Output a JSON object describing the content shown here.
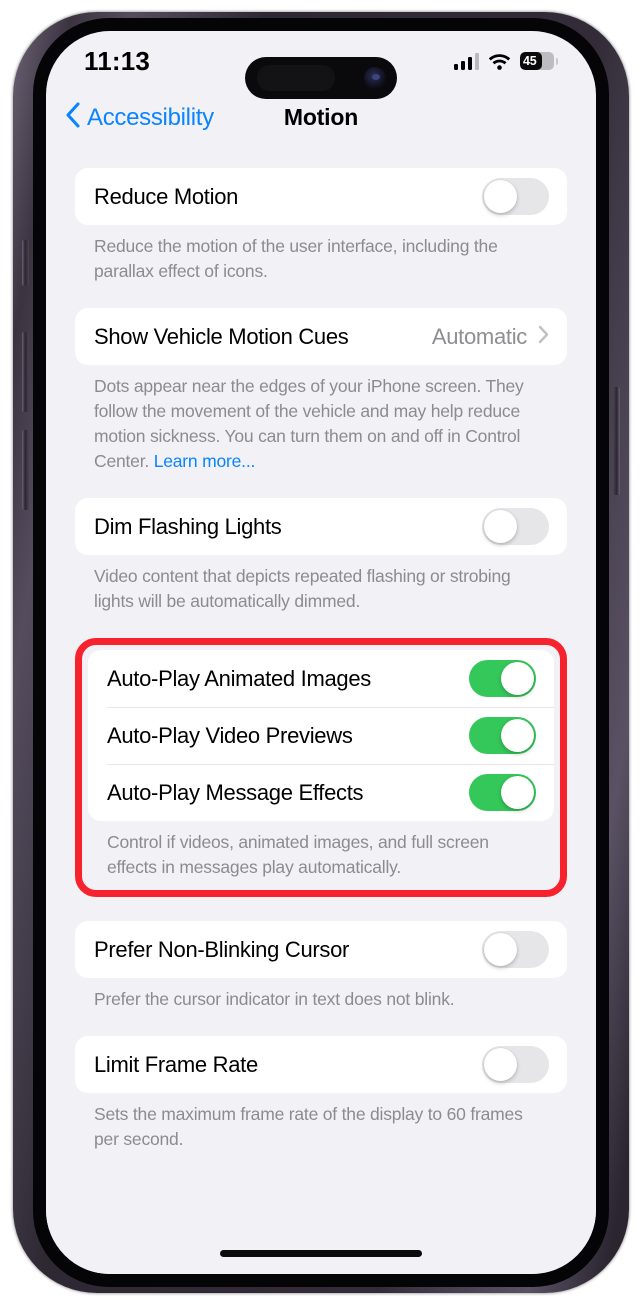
{
  "status_bar": {
    "time": "11:13",
    "signal_icon": "cellular-signal-icon",
    "signal_bars_filled": 3,
    "signal_bars_total": 4,
    "wifi_icon": "wifi-icon",
    "battery_percent": "45",
    "battery_icon": "battery-icon"
  },
  "nav": {
    "back_label": "Accessibility",
    "back_icon": "chevron-left-icon",
    "title": "Motion"
  },
  "colors": {
    "accent_blue": "#0a84ff",
    "toggle_on_green": "#34c759",
    "highlight_red": "#f6232f",
    "page_background": "#f2f1f6"
  },
  "sections": {
    "reduce_motion": {
      "label": "Reduce Motion",
      "toggle_state": "off",
      "footnote": "Reduce the motion of the user interface, including the parallax effect of icons."
    },
    "vehicle_motion_cues": {
      "label": "Show Vehicle Motion Cues",
      "value": "Automatic",
      "disclosure_icon": "chevron-right-icon",
      "footnote_text": "Dots appear near the edges of your iPhone screen. They follow the movement of the vehicle and may help reduce motion sickness. You can turn them on and off in Control Center. ",
      "footnote_link": "Learn more..."
    },
    "dim_flashing_lights": {
      "label": "Dim Flashing Lights",
      "toggle_state": "off",
      "footnote": "Video content that depicts repeated flashing or strobing lights will be automatically dimmed."
    },
    "auto_play": {
      "highlighted": true,
      "rows": [
        {
          "label": "Auto-Play Animated Images",
          "toggle_state": "on"
        },
        {
          "label": "Auto-Play Video Previews",
          "toggle_state": "on"
        },
        {
          "label": "Auto-Play Message Effects",
          "toggle_state": "on"
        }
      ],
      "footnote": "Control if videos, animated images, and full screen effects in messages play automatically."
    },
    "non_blinking_cursor": {
      "label": "Prefer Non-Blinking Cursor",
      "toggle_state": "off",
      "footnote": "Prefer the cursor indicator in text does not blink."
    },
    "limit_frame_rate": {
      "label": "Limit Frame Rate",
      "toggle_state": "off",
      "footnote": "Sets the maximum frame rate of the display to 60 frames per second."
    }
  }
}
